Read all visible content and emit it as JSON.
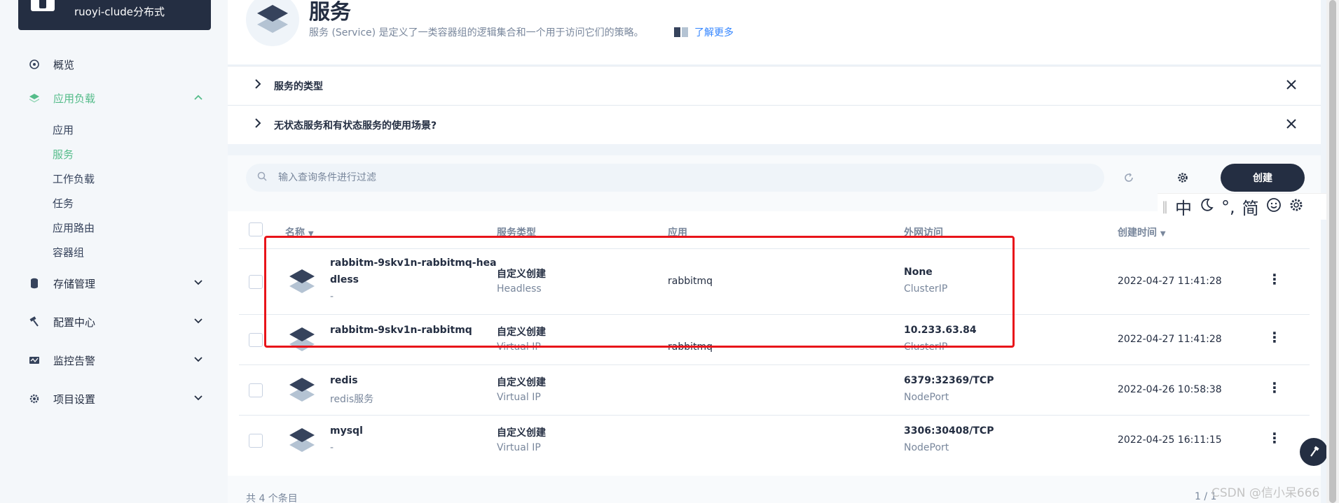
{
  "project": {
    "name": "ruoyi-clude分布式"
  },
  "sidebar": {
    "items": [
      {
        "label": "概览",
        "icon": "dashboard-icon"
      },
      {
        "label": "应用负载",
        "icon": "layers-icon"
      },
      {
        "label": "存储管理",
        "icon": "database-icon"
      },
      {
        "label": "配置中心",
        "icon": "hammer-icon"
      },
      {
        "label": "监控告警",
        "icon": "monitor-icon"
      },
      {
        "label": "项目设置",
        "icon": "gear-icon"
      }
    ],
    "sub_items": [
      "应用",
      "服务",
      "工作负载",
      "任务",
      "应用路由",
      "容器组"
    ],
    "active_sub": "服务"
  },
  "header": {
    "title": "服务",
    "description": "服务 (Service) 是定义了一类容器组的逻辑集合和一个用于访问它们的策略。",
    "learn_more": "了解更多"
  },
  "tips": [
    {
      "label": "服务的类型"
    },
    {
      "label": "无状态服务和有状态服务的使用场景?"
    }
  ],
  "toolbar": {
    "search_placeholder": "输入查询条件进行过滤",
    "create_label": "创建"
  },
  "table": {
    "columns": [
      "名称",
      "服务类型",
      "应用",
      "外网访问",
      "创建时间"
    ],
    "rows": [
      {
        "name_line1": "rabbitm-9skv1n-rabbitmq-hea",
        "name_line2": "dless",
        "description": "-",
        "type": "自定义创建",
        "type_sub": "Headless",
        "app": "rabbitmq",
        "access": "None",
        "access_sub": "ClusterIP",
        "created": "2022-04-27 11:41:28"
      },
      {
        "name_line1": "rabbitm-9skv1n-rabbitmq",
        "name_line2": "",
        "description": "",
        "type": "自定义创建",
        "type_sub": "Virtual IP",
        "app": "rabbitmq",
        "access": "10.233.63.84",
        "access_sub": "ClusterIP",
        "created": "2022-04-27 11:41:28"
      },
      {
        "name_line1": "redis",
        "name_line2": "",
        "description": "redis服务",
        "type": "自定义创建",
        "type_sub": "Virtual IP",
        "app": "",
        "access": "6379:32369/TCP",
        "access_sub": "NodePort",
        "created": "2022-04-26 10:58:38"
      },
      {
        "name_line1": "mysql",
        "name_line2": "",
        "description": "-",
        "type": "自定义创建",
        "type_sub": "Virtual IP",
        "app": "",
        "access": "3306:30408/TCP",
        "access_sub": "NodePort",
        "created": "2022-04-25 16:11:15"
      }
    ]
  },
  "footer": {
    "total": "共 4 个条目",
    "pagination": "1 / 1"
  },
  "ime": {
    "chars": [
      "中",
      "°,",
      "简"
    ]
  },
  "watermark": "CSDN @信小呆666",
  "colors": {
    "accent": "#55bc8a",
    "dark": "#242e42",
    "highlight": "#e8141a",
    "link": "#3385ff"
  }
}
